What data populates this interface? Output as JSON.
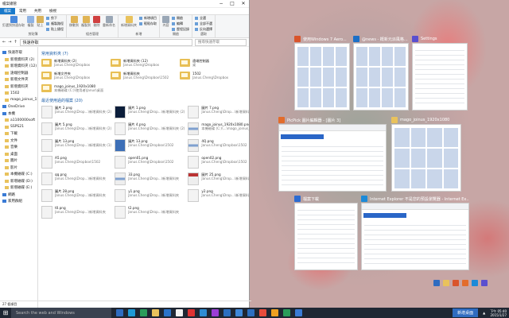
{
  "explorer": {
    "title": "檔案總管",
    "tabs": [
      "檔案",
      "常用",
      "共用",
      "檢視"
    ],
    "ribbon": {
      "clipboard": {
        "pin": "釘選到快速存取",
        "copy": "複製",
        "paste": "貼上",
        "cut": "剪下",
        "copy_path": "複製路徑",
        "paste_shortcut": "貼上捷徑",
        "group": "剪貼簿"
      },
      "organize": {
        "move_to": "移動到",
        "copy_to": "複製到",
        "delete": "刪除",
        "rename": "重新命名",
        "group": "組合管理"
      },
      "new": {
        "new_folder": "新增資料夾",
        "new_item": "新增項目",
        "easy_access": "輕鬆存取",
        "group": "新增"
      },
      "open": {
        "properties": "內容",
        "open": "開啟",
        "edit": "編輯",
        "history": "歷程記錄",
        "group": "開啟"
      },
      "select": {
        "select_all": "全選",
        "select_none": "全部不選",
        "invert": "反向選擇",
        "group": "選取"
      }
    },
    "address": "快速存取",
    "search_placeholder": "搜尋快速存取",
    "nav": [
      {
        "label": "快速存取",
        "kind": "group"
      },
      {
        "label": "新增資料夾 (2) ",
        "kind": "sub"
      },
      {
        "label": "新增資料夾 (12)",
        "kind": "sub"
      },
      {
        "label": "遠端控制器",
        "kind": "sub"
      },
      {
        "label": "新增文件夾",
        "kind": "sub"
      },
      {
        "label": "新增資料夾",
        "kind": "sub"
      },
      {
        "label": "1502",
        "kind": "sub"
      },
      {
        "label": "mago_joinus_15",
        "kind": "sub"
      },
      {
        "label": "OneDrive",
        "kind": "group"
      },
      {
        "label": "本機",
        "kind": "group"
      },
      {
        "label": "a1100000soft",
        "kind": "sub"
      },
      {
        "label": "SSPS21",
        "kind": "sub"
      },
      {
        "label": "下載",
        "kind": "sub"
      },
      {
        "label": "文件",
        "kind": "sub"
      },
      {
        "label": "音樂",
        "kind": "sub"
      },
      {
        "label": "桌面",
        "kind": "sub"
      },
      {
        "label": "圖片",
        "kind": "sub"
      },
      {
        "label": "影片",
        "kind": "sub"
      },
      {
        "label": "本機磁碟 (C:)",
        "kind": "sub"
      },
      {
        "label": "新增磁碟 (D:)",
        "kind": "sub"
      },
      {
        "label": "新增磁碟 (E:)",
        "kind": "sub"
      },
      {
        "label": "網路",
        "kind": "group"
      },
      {
        "label": "家用群組",
        "kind": "group"
      }
    ],
    "frequent_header": "常用資料夾 (7)",
    "frequent": [
      {
        "name": "新增資料夾 (2)",
        "sub": "Janus.Cheng\\Dropbox"
      },
      {
        "name": "新增資料夾 (12)",
        "sub": "Janus.Cheng\\Dropbox"
      },
      {
        "name": "遠端控制器",
        "sub": "桌"
      },
      {
        "name": "新增文件夾",
        "sub": "Janus.Cheng\\Dropbox"
      },
      {
        "name": "新增資料夾",
        "sub": "Janus.Cheng\\Dropbox\\1502"
      },
      {
        "name": "1502",
        "sub": "Janus.Cheng\\Dropbox"
      },
      {
        "name": "mago_joinus_1920x1080",
        "sub": "本機磁碟 (C:)\\使用者\\Janus\\桌面"
      }
    ],
    "recent_header": "最近使用過的檔案 (20)",
    "recent": [
      {
        "name": "圖片 2.png",
        "sub": "Janus.Cheng\\Drop...\\新增資料夾 (2)",
        "thumb": "plain"
      },
      {
        "name": "圖片 1.png",
        "sub": "Janus.Cheng\\Drop...\\新增資料夾 (2)",
        "thumb": "dark"
      },
      {
        "name": "圖片 7.png",
        "sub": "Janus.Cheng\\Drop...\\新增資料夾 (2)",
        "thumb": "plain"
      },
      {
        "name": "圖片 5.png",
        "sub": "Janus.Cheng\\Drop...\\新增資料夾 (2)",
        "thumb": "plain"
      },
      {
        "name": "圖片 4.png",
        "sub": "Janus.Cheng\\Drop...\\新增資料夾 (2)",
        "thumb": "plain"
      },
      {
        "name": "mago_joinus_1920x1080.png",
        "sub": "本機磁碟 (C:)\\...\\mago_joinus_1920x1080",
        "thumb": "mix"
      },
      {
        "name": "圖片 13.png",
        "sub": "Janus.Cheng\\Drop...\\新增資料夾 (1)",
        "thumb": "plain"
      },
      {
        "name": "圖片 13.png",
        "sub": "Janus.Cheng\\Dropbox\\1502",
        "thumb": "blue"
      },
      {
        "name": "4Q.png",
        "sub": "Janus.Cheng\\Dropbox\\1502",
        "thumb": "mix"
      },
      {
        "name": "A5.png",
        "sub": "Janus.Cheng\\Dropbox\\1502",
        "thumb": "plain"
      },
      {
        "name": "open01.png",
        "sub": "Janus.Cheng\\Dropbox\\1502",
        "thumb": "plain"
      },
      {
        "name": "open02.png",
        "sub": "Janus.Cheng\\Dropbox\\1502",
        "thumb": "plain"
      },
      {
        "name": "qq.png",
        "sub": "Janus.Cheng\\Drop...\\新增資料夾",
        "thumb": "plain"
      },
      {
        "name": "33.png",
        "sub": "Janus.Cheng\\Drop...\\新增資料夾",
        "thumb": "mix"
      },
      {
        "name": "圖片 25.png",
        "sub": "Janus.Cheng\\Drop...\\新增資料夾",
        "thumb": "red"
      },
      {
        "name": "圖片 28.png",
        "sub": "Janus.Cheng\\Drop...\\新增資料夾",
        "thumb": "plain"
      },
      {
        "name": "y1.png",
        "sub": "Janus.Cheng\\Drop...\\新增資料夾",
        "thumb": "plain"
      },
      {
        "name": "y2.png",
        "sub": "Janus.Cheng\\Drop...\\新增資料夾",
        "thumb": "plain"
      },
      {
        "name": "t0.png",
        "sub": "Janus.Cheng\\Drop...\\新增資料夾",
        "thumb": "plain"
      },
      {
        "name": "t2.png",
        "sub": "Janus.Cheng\\Drop...\\新增資料夾",
        "thumb": "plain"
      }
    ],
    "status": "27 個項目"
  },
  "taskview": [
    {
      "title": "使用Windows 7 Aero...",
      "icon_color": "#d9542b",
      "style": "grid"
    },
    {
      "title": "@news - 概新元派風格...",
      "icon_color": "#1c6fc7",
      "style": "grid"
    },
    {
      "title": "Settings",
      "icon_color": "#5a4fcf",
      "style": "lines"
    },
    {
      "title": "PicPick 圖片編輯器 - [圖片 3]",
      "icon_color": "#e26c2c",
      "style": "toolbar"
    },
    {
      "title": "mago_joinus_1920x1080",
      "icon_color": "#e9c25c",
      "style": "grid"
    },
    {
      "title": "檔案下載",
      "icon_color": "#2c6bd1",
      "style": "lines"
    },
    {
      "title": "Internet Explorer 不是您的預設瀏覽器 - Internet Ex...",
      "icon_color": "#1c8ad8",
      "style": "toolbar"
    }
  ],
  "taskbar": {
    "start_icon": "windows-logo-icon",
    "search_placeholder": "Search the web and Windows",
    "apps": [
      "#2f6cc0",
      "#1f9ad6",
      "#2a9d5a",
      "#e9c25c",
      "#2b73c9",
      "#f2f2f2",
      "#d33",
      "#2d8cd3",
      "#9b3dd6",
      "#2c6fc0",
      "#3f88d9",
      "#2c6fc0",
      "#e74c3c",
      "#f0a020",
      "#2a9d5a",
      "#3a7bd5"
    ],
    "new_desktop": "新增桌面",
    "time": "下午 05:40",
    "date": "2015/1/27"
  }
}
